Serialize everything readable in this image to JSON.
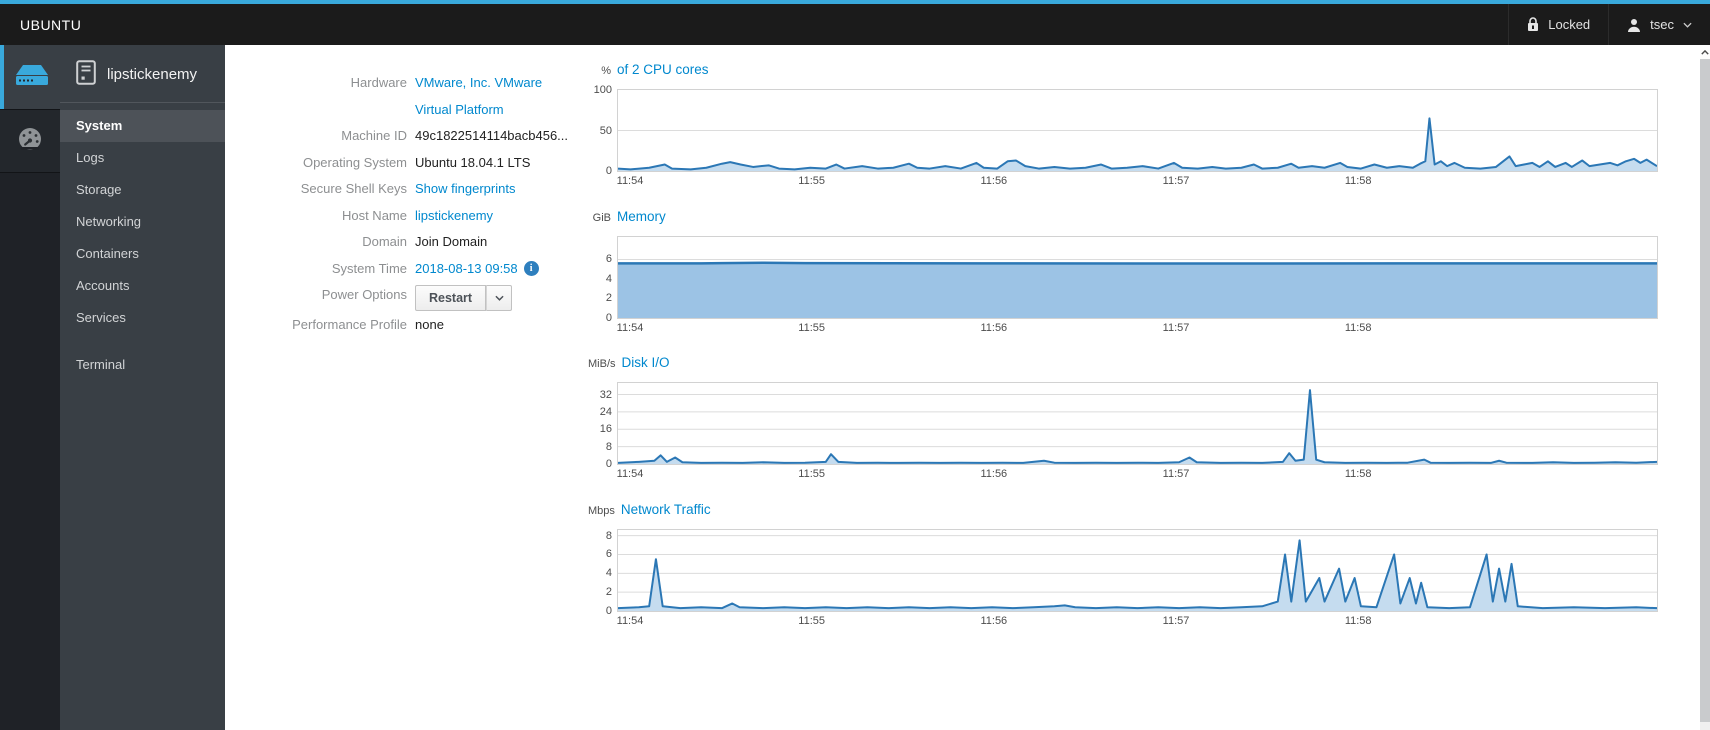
{
  "topbar": {
    "brand": "UBUNTU",
    "locked_label": "Locked",
    "user": "tsec"
  },
  "icons": {
    "strip_primary": "server-icon",
    "strip_secondary": "gauge-icon",
    "host": "host-icon",
    "topbar_lock": "lock-icon",
    "topbar_user": "user-icon",
    "topbar_chevron": "chevron-down-icon",
    "system_time_info": "info-icon",
    "power_caret": "chevron-down-icon",
    "scrollbar_up": "scroll-up-icon"
  },
  "colors": {
    "accent": "#39a9dc",
    "link": "#0088ce",
    "topbar_bg": "#1b1b1b",
    "sidebar_bg": "#393f45",
    "sidebar_active_bg": "#4d5258",
    "chart_line": "#2b77b5",
    "chart_fill": "#c5dcef",
    "memory_fill": "#9cc3e5"
  },
  "sidebar": {
    "hostname": "lipstickenemy",
    "items": [
      {
        "label": "System",
        "active": true
      },
      {
        "label": "Logs",
        "active": false
      },
      {
        "label": "Storage",
        "active": false
      },
      {
        "label": "Networking",
        "active": false
      },
      {
        "label": "Containers",
        "active": false
      },
      {
        "label": "Accounts",
        "active": false
      },
      {
        "label": "Services",
        "active": false
      },
      {
        "label": "Terminal",
        "active": false
      }
    ]
  },
  "system": {
    "rows": [
      {
        "label": "Hardware",
        "value": "VMware, Inc. VMware Virtual Platform",
        "type": "link"
      },
      {
        "label": "Machine ID",
        "value": "49c1822514114bacb456...",
        "type": "text"
      },
      {
        "label": "Operating System",
        "value": "Ubuntu 18.04.1 LTS",
        "type": "text"
      },
      {
        "label": "Secure Shell Keys",
        "value": "Show fingerprints",
        "type": "link"
      },
      {
        "label": "Host Name",
        "value": "lipstickenemy",
        "type": "link"
      },
      {
        "label": "Domain",
        "value": "Join Domain",
        "type": "text"
      },
      {
        "label": "System Time",
        "value": "2018-08-13 09:58",
        "type": "link-with-info"
      },
      {
        "label": "Power Options",
        "value": "Restart",
        "type": "split-button"
      },
      {
        "label": "Performance Profile",
        "value": "none",
        "type": "text"
      }
    ]
  },
  "chart_data": {
    "note": "see charts array",
    "type": "area"
  },
  "charts": [
    {
      "type": "area",
      "unit": "%",
      "title": "of 2 CPU cores",
      "ymax": 100,
      "yticks": [
        100,
        50,
        0
      ],
      "line_width": 2,
      "line": "#2b77b5",
      "fill": "#c5dcef",
      "xticks": [
        {
          "f": 0.0125,
          "label": "11:54"
        },
        {
          "f": 0.187,
          "label": "11:55"
        },
        {
          "f": 0.362,
          "label": "11:56"
        },
        {
          "f": 0.537,
          "label": "11:57"
        },
        {
          "f": 0.712,
          "label": "11:58"
        }
      ],
      "points": [
        [
          0,
          3
        ],
        [
          0.012,
          2
        ],
        [
          0.03,
          4
        ],
        [
          0.045,
          8
        ],
        [
          0.052,
          3
        ],
        [
          0.07,
          2
        ],
        [
          0.085,
          4
        ],
        [
          0.1,
          9
        ],
        [
          0.108,
          11
        ],
        [
          0.118,
          8
        ],
        [
          0.13,
          5
        ],
        [
          0.145,
          7
        ],
        [
          0.155,
          3
        ],
        [
          0.17,
          2
        ],
        [
          0.185,
          4
        ],
        [
          0.2,
          3
        ],
        [
          0.21,
          8
        ],
        [
          0.218,
          3
        ],
        [
          0.235,
          6
        ],
        [
          0.25,
          3
        ],
        [
          0.265,
          4
        ],
        [
          0.28,
          9
        ],
        [
          0.288,
          4
        ],
        [
          0.3,
          3
        ],
        [
          0.315,
          6
        ],
        [
          0.33,
          3
        ],
        [
          0.345,
          10
        ],
        [
          0.352,
          4
        ],
        [
          0.365,
          3
        ],
        [
          0.375,
          12
        ],
        [
          0.383,
          13
        ],
        [
          0.392,
          6
        ],
        [
          0.405,
          3
        ],
        [
          0.42,
          5
        ],
        [
          0.435,
          3
        ],
        [
          0.45,
          4
        ],
        [
          0.465,
          8
        ],
        [
          0.475,
          3
        ],
        [
          0.49,
          4
        ],
        [
          0.505,
          6
        ],
        [
          0.52,
          3
        ],
        [
          0.535,
          10
        ],
        [
          0.543,
          4
        ],
        [
          0.558,
          3
        ],
        [
          0.572,
          5
        ],
        [
          0.585,
          3
        ],
        [
          0.6,
          4
        ],
        [
          0.612,
          8
        ],
        [
          0.62,
          3
        ],
        [
          0.635,
          4
        ],
        [
          0.648,
          9
        ],
        [
          0.655,
          4
        ],
        [
          0.668,
          6
        ],
        [
          0.68,
          4
        ],
        [
          0.695,
          10
        ],
        [
          0.702,
          5
        ],
        [
          0.715,
          3
        ],
        [
          0.728,
          8
        ],
        [
          0.74,
          4
        ],
        [
          0.752,
          6
        ],
        [
          0.765,
          4
        ],
        [
          0.772,
          9
        ],
        [
          0.777,
          12
        ],
        [
          0.781,
          65
        ],
        [
          0.786,
          8
        ],
        [
          0.792,
          12
        ],
        [
          0.798,
          6
        ],
        [
          0.805,
          10
        ],
        [
          0.815,
          4
        ],
        [
          0.83,
          3
        ],
        [
          0.845,
          5
        ],
        [
          0.858,
          18
        ],
        [
          0.864,
          6
        ],
        [
          0.872,
          8
        ],
        [
          0.88,
          10
        ],
        [
          0.887,
          5
        ],
        [
          0.895,
          12
        ],
        [
          0.902,
          5
        ],
        [
          0.912,
          10
        ],
        [
          0.918,
          5
        ],
        [
          0.928,
          13
        ],
        [
          0.935,
          6
        ],
        [
          0.945,
          8
        ],
        [
          0.955,
          10
        ],
        [
          0.962,
          7
        ],
        [
          0.97,
          12
        ],
        [
          0.978,
          15
        ],
        [
          0.984,
          10
        ],
        [
          0.99,
          14
        ],
        [
          1,
          6
        ]
      ]
    },
    {
      "type": "area",
      "unit": "GiB",
      "title": "Memory",
      "ymax": 8.3,
      "yticks": [
        6,
        4,
        2,
        0
      ],
      "line_width": 2.5,
      "line": "#2b77b5",
      "fill": "#9cc3e5",
      "xticks": [
        {
          "f": 0.0125,
          "label": "11:54"
        },
        {
          "f": 0.187,
          "label": "11:55"
        },
        {
          "f": 0.362,
          "label": "11:56"
        },
        {
          "f": 0.537,
          "label": "11:57"
        },
        {
          "f": 0.712,
          "label": "11:58"
        }
      ],
      "points": [
        [
          0,
          5.6
        ],
        [
          0.08,
          5.6
        ],
        [
          0.1,
          5.62
        ],
        [
          0.14,
          5.66
        ],
        [
          0.18,
          5.62
        ],
        [
          0.35,
          5.6
        ],
        [
          0.55,
          5.58
        ],
        [
          0.75,
          5.6
        ],
        [
          1,
          5.6
        ]
      ]
    },
    {
      "type": "area",
      "unit": "MiB/s",
      "title": "Disk I/O",
      "ymax": 37.3,
      "yticks": [
        32,
        24,
        16,
        8,
        0
      ],
      "line_width": 2,
      "line": "#2b77b5",
      "fill": "#c5dcef",
      "xticks": [
        {
          "f": 0.0125,
          "label": "11:54"
        },
        {
          "f": 0.187,
          "label": "11:55"
        },
        {
          "f": 0.362,
          "label": "11:56"
        },
        {
          "f": 0.537,
          "label": "11:57"
        },
        {
          "f": 0.712,
          "label": "11:58"
        }
      ],
      "points": [
        [
          0,
          0.5
        ],
        [
          0.02,
          1
        ],
        [
          0.035,
          1.5
        ],
        [
          0.041,
          4
        ],
        [
          0.047,
          1
        ],
        [
          0.055,
          3
        ],
        [
          0.062,
          0.8
        ],
        [
          0.08,
          0.5
        ],
        [
          0.1,
          0.6
        ],
        [
          0.12,
          0.5
        ],
        [
          0.14,
          0.8
        ],
        [
          0.16,
          0.5
        ],
        [
          0.18,
          0.6
        ],
        [
          0.2,
          1
        ],
        [
          0.205,
          4.5
        ],
        [
          0.212,
          1
        ],
        [
          0.23,
          0.5
        ],
        [
          0.25,
          0.6
        ],
        [
          0.27,
          0.5
        ],
        [
          0.29,
          0.6
        ],
        [
          0.31,
          0.5
        ],
        [
          0.33,
          0.6
        ],
        [
          0.35,
          0.5
        ],
        [
          0.37,
          0.6
        ],
        [
          0.39,
          0.5
        ],
        [
          0.41,
          1.5
        ],
        [
          0.42,
          0.6
        ],
        [
          0.44,
          0.5
        ],
        [
          0.46,
          0.6
        ],
        [
          0.48,
          0.5
        ],
        [
          0.5,
          0.6
        ],
        [
          0.52,
          0.5
        ],
        [
          0.54,
          0.8
        ],
        [
          0.55,
          3
        ],
        [
          0.557,
          0.8
        ],
        [
          0.58,
          0.5
        ],
        [
          0.6,
          0.6
        ],
        [
          0.62,
          0.5
        ],
        [
          0.64,
          1
        ],
        [
          0.646,
          5
        ],
        [
          0.652,
          1.5
        ],
        [
          0.66,
          2
        ],
        [
          0.666,
          34
        ],
        [
          0.672,
          2
        ],
        [
          0.68,
          0.8
        ],
        [
          0.7,
          0.5
        ],
        [
          0.72,
          0.6
        ],
        [
          0.74,
          0.5
        ],
        [
          0.76,
          0.6
        ],
        [
          0.776,
          2
        ],
        [
          0.782,
          0.6
        ],
        [
          0.8,
          0.5
        ],
        [
          0.82,
          0.6
        ],
        [
          0.84,
          0.5
        ],
        [
          0.848,
          1.5
        ],
        [
          0.855,
          0.6
        ],
        [
          0.88,
          0.5
        ],
        [
          0.9,
          0.8
        ],
        [
          0.92,
          0.5
        ],
        [
          0.94,
          0.6
        ],
        [
          0.96,
          0.8
        ],
        [
          0.98,
          0.6
        ],
        [
          1,
          1
        ]
      ]
    },
    {
      "type": "area",
      "unit": "Mbps",
      "title": "Network Traffic",
      "ymax": 8.6,
      "yticks": [
        8,
        6,
        4,
        2,
        0
      ],
      "line_width": 2,
      "line": "#2b77b5",
      "fill": "#c5dcef",
      "xticks": [
        {
          "f": 0.0125,
          "label": "11:54"
        },
        {
          "f": 0.187,
          "label": "11:55"
        },
        {
          "f": 0.362,
          "label": "11:56"
        },
        {
          "f": 0.537,
          "label": "11:57"
        },
        {
          "f": 0.712,
          "label": "11:58"
        }
      ],
      "points": [
        [
          0,
          0.3
        ],
        [
          0.02,
          0.4
        ],
        [
          0.03,
          0.5
        ],
        [
          0.0365,
          5.5
        ],
        [
          0.043,
          0.5
        ],
        [
          0.06,
          0.3
        ],
        [
          0.08,
          0.4
        ],
        [
          0.1,
          0.3
        ],
        [
          0.11,
          0.8
        ],
        [
          0.117,
          0.4
        ],
        [
          0.14,
          0.3
        ],
        [
          0.16,
          0.4
        ],
        [
          0.18,
          0.3
        ],
        [
          0.2,
          0.4
        ],
        [
          0.22,
          0.3
        ],
        [
          0.24,
          0.4
        ],
        [
          0.26,
          0.3
        ],
        [
          0.28,
          0.4
        ],
        [
          0.3,
          0.3
        ],
        [
          0.32,
          0.4
        ],
        [
          0.34,
          0.3
        ],
        [
          0.36,
          0.4
        ],
        [
          0.38,
          0.3
        ],
        [
          0.4,
          0.4
        ],
        [
          0.42,
          0.5
        ],
        [
          0.43,
          0.6
        ],
        [
          0.44,
          0.4
        ],
        [
          0.46,
          0.3
        ],
        [
          0.48,
          0.4
        ],
        [
          0.5,
          0.3
        ],
        [
          0.52,
          0.4
        ],
        [
          0.54,
          0.3
        ],
        [
          0.56,
          0.4
        ],
        [
          0.58,
          0.3
        ],
        [
          0.6,
          0.4
        ],
        [
          0.62,
          0.5
        ],
        [
          0.635,
          1
        ],
        [
          0.642,
          6
        ],
        [
          0.648,
          1
        ],
        [
          0.656,
          7.5
        ],
        [
          0.662,
          1
        ],
        [
          0.675,
          3.5
        ],
        [
          0.68,
          1
        ],
        [
          0.694,
          4.5
        ],
        [
          0.7,
          1
        ],
        [
          0.709,
          3.5
        ],
        [
          0.715,
          0.5
        ],
        [
          0.73,
          0.4
        ],
        [
          0.747,
          6
        ],
        [
          0.753,
          0.8
        ],
        [
          0.762,
          3.5
        ],
        [
          0.768,
          0.8
        ],
        [
          0.773,
          3
        ],
        [
          0.779,
          0.4
        ],
        [
          0.8,
          0.3
        ],
        [
          0.82,
          0.4
        ],
        [
          0.836,
          6
        ],
        [
          0.842,
          1
        ],
        [
          0.848,
          4.5
        ],
        [
          0.854,
          1
        ],
        [
          0.86,
          5
        ],
        [
          0.866,
          0.5
        ],
        [
          0.89,
          0.3
        ],
        [
          0.92,
          0.4
        ],
        [
          0.95,
          0.3
        ],
        [
          0.98,
          0.4
        ],
        [
          1,
          0.3
        ]
      ]
    }
  ]
}
